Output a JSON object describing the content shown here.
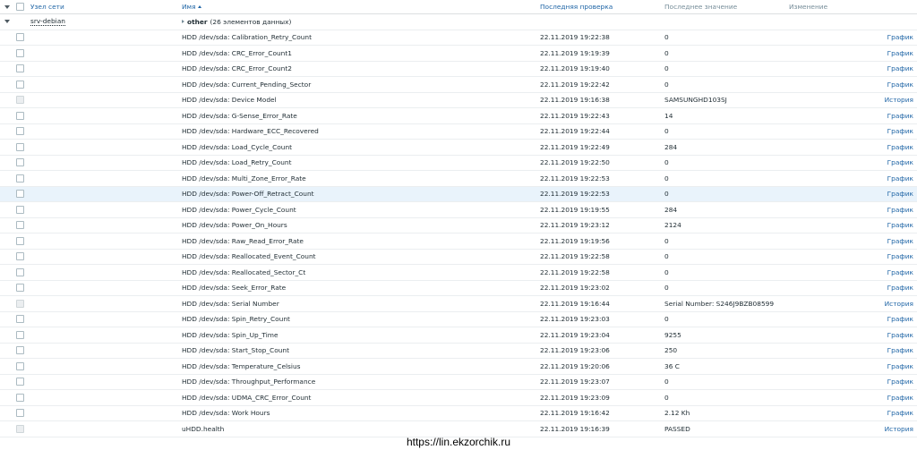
{
  "header": {
    "host": "Узел сети",
    "name": "Имя",
    "last_check": "Последняя проверка",
    "last_value": "Последнее значение",
    "change": "Изменение"
  },
  "host_row": {
    "host": "srv-debian",
    "group_name": "other",
    "group_count": "(26 элементов данных)"
  },
  "items": [
    {
      "name": "HDD /dev/sda: Calibration_Retry_Count",
      "time": "22.11.2019 19:22:38",
      "value": "0",
      "action": "График",
      "enabled": true
    },
    {
      "name": "HDD /dev/sda: CRC_Error_Count1",
      "time": "22.11.2019 19:19:39",
      "value": "0",
      "action": "График",
      "enabled": true
    },
    {
      "name": "HDD /dev/sda: CRC_Error_Count2",
      "time": "22.11.2019 19:19:40",
      "value": "0",
      "action": "График",
      "enabled": true
    },
    {
      "name": "HDD /dev/sda: Current_Pending_Sector",
      "time": "22.11.2019 19:22:42",
      "value": "0",
      "action": "График",
      "enabled": true
    },
    {
      "name": "HDD /dev/sda: Device Model",
      "time": "22.11.2019 19:16:38",
      "value": "SAMSUNGHD103SJ",
      "action": "История",
      "enabled": false
    },
    {
      "name": "HDD /dev/sda: G-Sense_Error_Rate",
      "time": "22.11.2019 19:22:43",
      "value": "14",
      "action": "График",
      "enabled": true
    },
    {
      "name": "HDD /dev/sda: Hardware_ECC_Recovered",
      "time": "22.11.2019 19:22:44",
      "value": "0",
      "action": "График",
      "enabled": true
    },
    {
      "name": "HDD /dev/sda: Load_Cycle_Count",
      "time": "22.11.2019 19:22:49",
      "value": "284",
      "action": "График",
      "enabled": true
    },
    {
      "name": "HDD /dev/sda: Load_Retry_Count",
      "time": "22.11.2019 19:22:50",
      "value": "0",
      "action": "График",
      "enabled": true
    },
    {
      "name": "HDD /dev/sda: Multi_Zone_Error_Rate",
      "time": "22.11.2019 19:22:53",
      "value": "0",
      "action": "График",
      "enabled": true
    },
    {
      "name": "HDD /dev/sda: Power-Off_Retract_Count",
      "time": "22.11.2019 19:22:53",
      "value": "0",
      "action": "График",
      "enabled": true,
      "highlight": true
    },
    {
      "name": "HDD /dev/sda: Power_Cycle_Count",
      "time": "22.11.2019 19:19:55",
      "value": "284",
      "action": "График",
      "enabled": true
    },
    {
      "name": "HDD /dev/sda: Power_On_Hours",
      "time": "22.11.2019 19:23:12",
      "value": "2124",
      "action": "График",
      "enabled": true
    },
    {
      "name": "HDD /dev/sda: Raw_Read_Error_Rate",
      "time": "22.11.2019 19:19:56",
      "value": "0",
      "action": "График",
      "enabled": true
    },
    {
      "name": "HDD /dev/sda: Reallocated_Event_Count",
      "time": "22.11.2019 19:22:58",
      "value": "0",
      "action": "График",
      "enabled": true
    },
    {
      "name": "HDD /dev/sda: Reallocated_Sector_Ct",
      "time": "22.11.2019 19:22:58",
      "value": "0",
      "action": "График",
      "enabled": true
    },
    {
      "name": "HDD /dev/sda: Seek_Error_Rate",
      "time": "22.11.2019 19:23:02",
      "value": "0",
      "action": "График",
      "enabled": true
    },
    {
      "name": "HDD /dev/sda: Serial Number",
      "time": "22.11.2019 19:16:44",
      "value": "Serial Number: S246J9BZB08599",
      "action": "История",
      "enabled": false
    },
    {
      "name": "HDD /dev/sda: Spin_Retry_Count",
      "time": "22.11.2019 19:23:03",
      "value": "0",
      "action": "График",
      "enabled": true
    },
    {
      "name": "HDD /dev/sda: Spin_Up_Time",
      "time": "22.11.2019 19:23:04",
      "value": "9255",
      "action": "График",
      "enabled": true
    },
    {
      "name": "HDD /dev/sda: Start_Stop_Count",
      "time": "22.11.2019 19:23:06",
      "value": "250",
      "action": "График",
      "enabled": true
    },
    {
      "name": "HDD /dev/sda: Temperature_Celsius",
      "time": "22.11.2019 19:20:06",
      "value": "36 C",
      "action": "График",
      "enabled": true
    },
    {
      "name": "HDD /dev/sda: Throughput_Performance",
      "time": "22.11.2019 19:23:07",
      "value": "0",
      "action": "График",
      "enabled": true
    },
    {
      "name": "HDD /dev/sda: UDMA_CRC_Error_Count",
      "time": "22.11.2019 19:23:09",
      "value": "0",
      "action": "График",
      "enabled": true
    },
    {
      "name": "HDD /dev/sda: Work Hours",
      "time": "22.11.2019 19:16:42",
      "value": "2.12 Kh",
      "action": "График",
      "enabled": true
    },
    {
      "name": "uHDD.health",
      "time": "22.11.2019 19:16:39",
      "value": "PASSED",
      "action": "История",
      "enabled": false
    }
  ],
  "watermark": "https://lin.ekzorchik.ru"
}
